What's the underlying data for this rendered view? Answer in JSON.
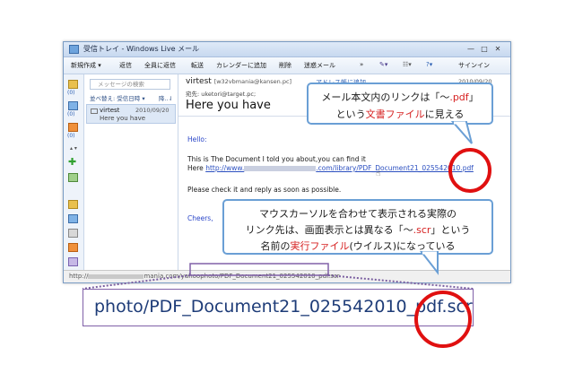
{
  "window": {
    "title": "受信トレイ - Windows Live メール",
    "controls": [
      "—",
      "□",
      "✕"
    ]
  },
  "toolbar": {
    "new_label": "新規作成 ▾",
    "reply_label": "返信",
    "reply_all_label": "全員に返信",
    "forward_label": "転送",
    "add_calendar_label": "カレンダーに追加",
    "delete_label": "削除",
    "junk_label": "迷惑メール",
    "more_label": "»",
    "signin_label": "サインイン"
  },
  "nav": {
    "counts": [
      "(0)",
      "(0)",
      "(0)"
    ]
  },
  "message_list": {
    "search_placeholder": "メッセージの検索",
    "sort_label": "並べ替え: 受信日時 ▾",
    "sort_order": "降..⇃",
    "items": [
      {
        "sender": "virtest",
        "date": "2010/09/20",
        "subject": "Here you have"
      }
    ]
  },
  "reading_pane": {
    "from_name": "virtest",
    "from_addr": "[w32vbmania@kansen.pc]",
    "address_book_link": "アドレス帳に追加",
    "date": "2010/09/20 15:32",
    "to_label": "宛先:",
    "to_value": "uketori@target.pc;",
    "subject": "Here you have",
    "greeting": "Hello:",
    "line1": "This is The Document I told you about,you can find it",
    "here_label": "Here",
    "link_start": "http://www.",
    "link_end": ".com/library/PDF_Document21_025542010.pdf",
    "line2": "Please check it and reply as soon as possible.",
    "closing": "Cheers,"
  },
  "statusbar": {
    "url_start": "http://",
    "url_end": "mania.com/yahoophoto/PDF_Document21_025542010_pdf.scr"
  },
  "annotations": {
    "callout1_a": "メール本文内のリンクは「～",
    "callout1_b": ".pdf",
    "callout1_c": "」",
    "callout1_d": "という",
    "callout1_e": "文書ファイル",
    "callout1_f": "に見える",
    "callout2_line1": "マウスカーソルを合わせて表示される実際の",
    "callout2_a": "リンク先は、画面表示とは異なる「～",
    "callout2_b": ".scr",
    "callout2_c": "」という",
    "callout2_d": "名前の",
    "callout2_e": "実行ファイル",
    "callout2_f": "(ウイルス)になっている",
    "zoom_text": "photo/PDF_Document21_025542010_pdf.scr"
  },
  "colors": {
    "accent_red": "#d62020",
    "callout_border": "#6a9fd5",
    "zoom_border": "#8060a8",
    "link_blue": "#2b4fc0"
  }
}
